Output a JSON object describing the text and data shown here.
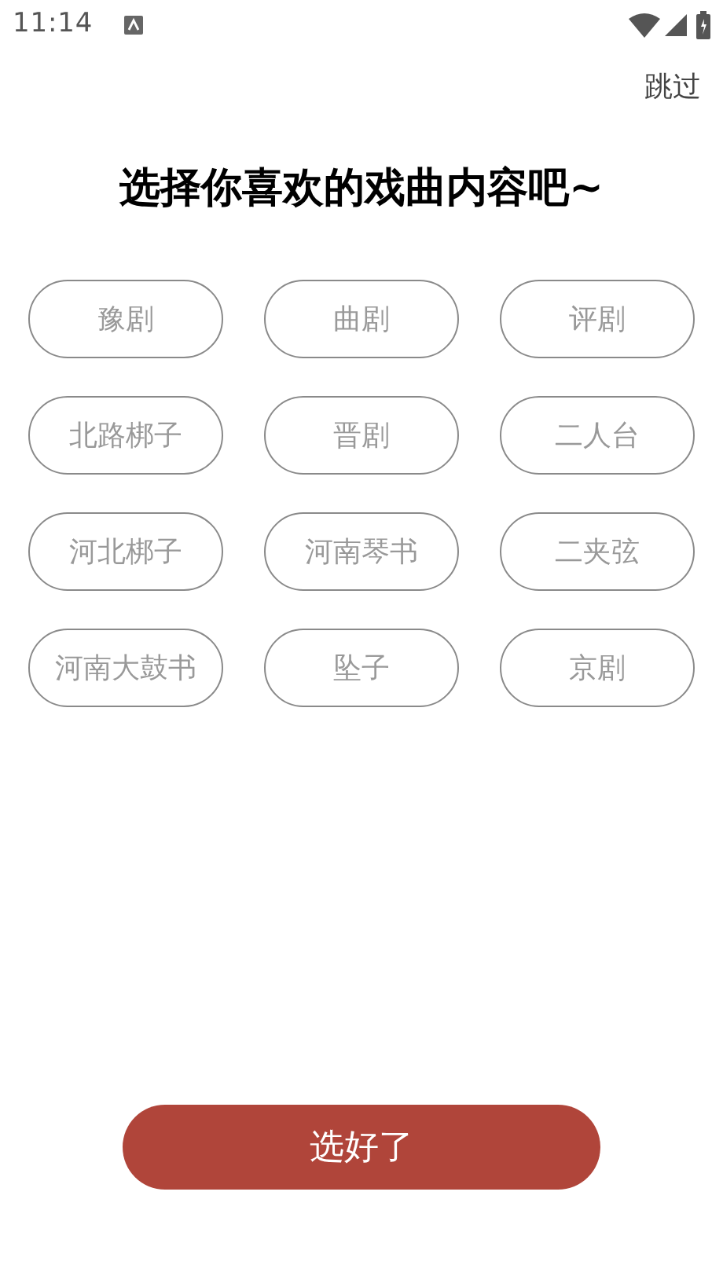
{
  "status_bar": {
    "time": "11:14"
  },
  "skip": "跳过",
  "title": "选择你喜欢的戏曲内容吧~",
  "options": [
    {
      "label": "豫剧",
      "selected": false
    },
    {
      "label": "曲剧",
      "selected": false
    },
    {
      "label": "评剧",
      "selected": false
    },
    {
      "label": "北路梆子",
      "selected": false
    },
    {
      "label": "晋剧",
      "selected": false
    },
    {
      "label": "二人台",
      "selected": false
    },
    {
      "label": "河北梆子",
      "selected": false
    },
    {
      "label": "河南琴书",
      "selected": false
    },
    {
      "label": "二夹弦",
      "selected": false
    },
    {
      "label": "河南大鼓书",
      "selected": false
    },
    {
      "label": "坠子",
      "selected": false
    },
    {
      "label": "京剧",
      "selected": false
    }
  ],
  "confirm_button": "选好了"
}
